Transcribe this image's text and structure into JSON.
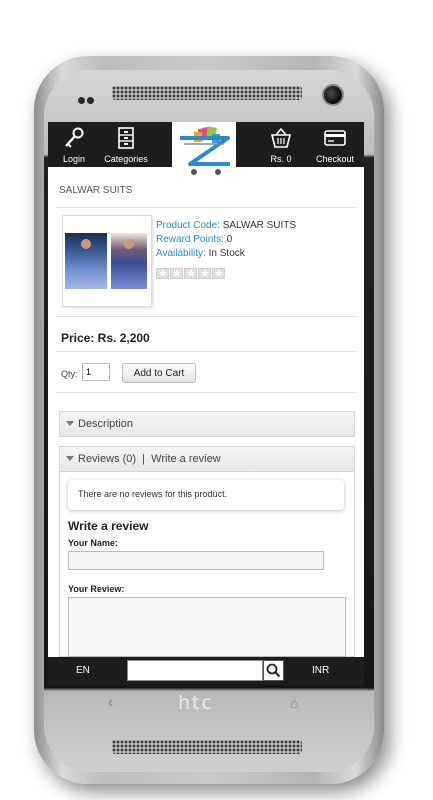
{
  "nav": {
    "login": "Login",
    "categories": "Categories",
    "cart": "Rs. 0",
    "checkout": "Checkout"
  },
  "category": "SALWAR SUITS",
  "product": {
    "code_label": "Product Code:",
    "code": "SALWAR SUITS",
    "reward_label": "Reward Points:",
    "reward": "0",
    "availability_label": "Availability:",
    "availability": "In Stock",
    "rating_stars": 0
  },
  "price": "Price: Rs. 2,200",
  "cart_form": {
    "qty_label": "Qty:",
    "qty_value": "1",
    "add_to_cart": "Add to Cart"
  },
  "tabs": {
    "description": "Description",
    "reviews": "Reviews (0)  |  Write a review"
  },
  "reviews": {
    "empty": "There are no reviews for this product.",
    "write_title": "Write a review",
    "name_label": "Your Name:",
    "review_label": "Your Review:"
  },
  "footer": {
    "language": "EN",
    "currency": "INR"
  },
  "device": {
    "brand": "htc"
  }
}
